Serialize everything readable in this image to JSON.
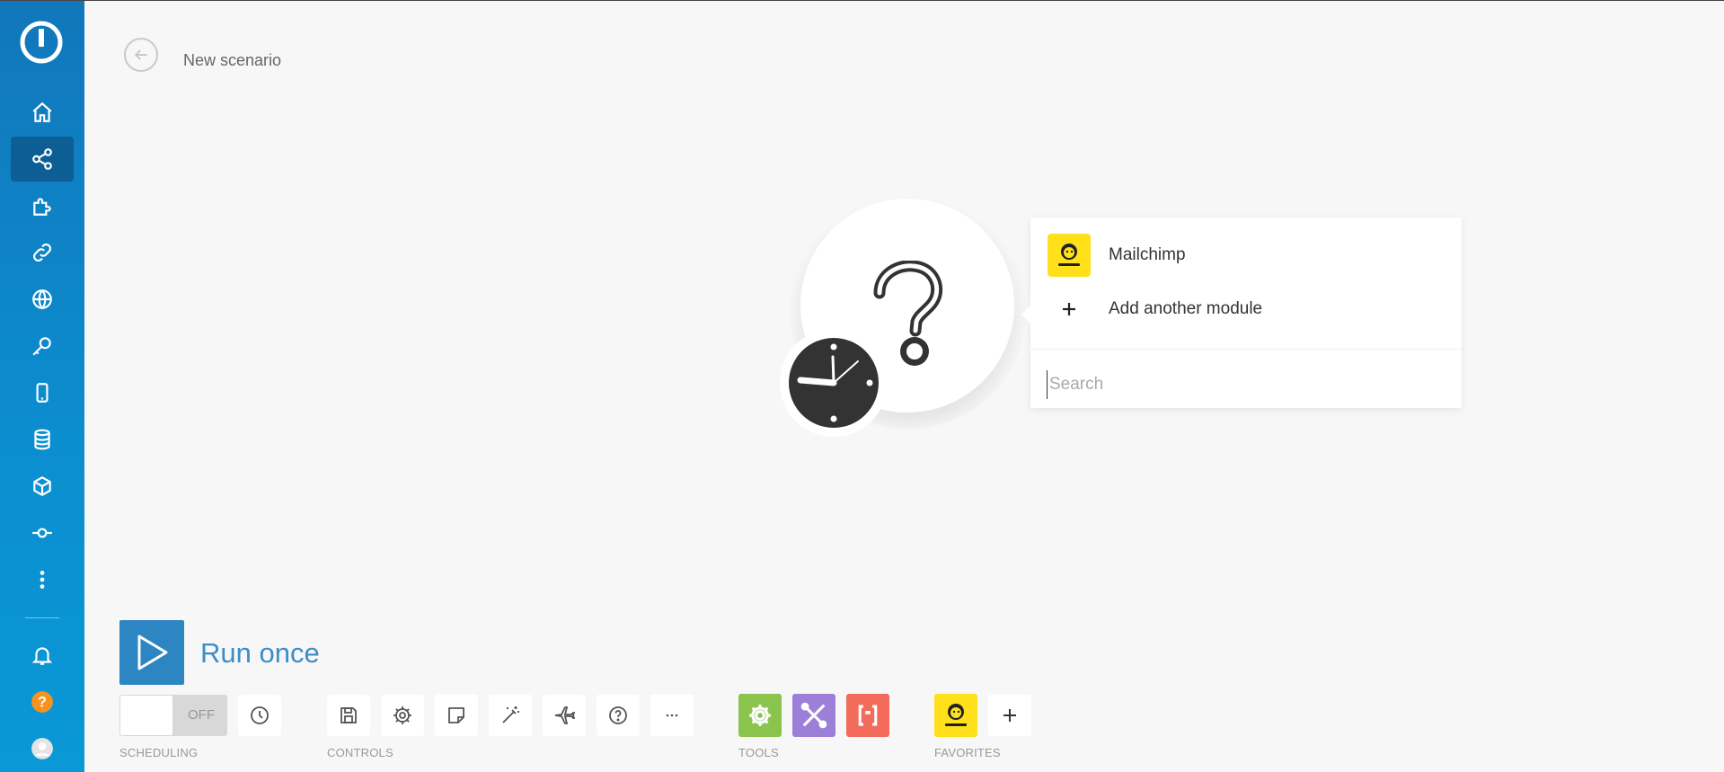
{
  "window": {
    "title": "New scenario"
  },
  "sidebar": {
    "items": [
      {
        "name": "home-icon"
      },
      {
        "name": "share-icon",
        "active": true
      },
      {
        "name": "puzzle-icon"
      },
      {
        "name": "link-icon"
      },
      {
        "name": "globe-icon"
      },
      {
        "name": "key-icon"
      },
      {
        "name": "mobile-icon"
      },
      {
        "name": "database-icon"
      },
      {
        "name": "cube-icon"
      },
      {
        "name": "commit-icon"
      },
      {
        "name": "more-vertical-icon"
      }
    ],
    "bottom": [
      {
        "name": "bell-icon"
      },
      {
        "name": "help-icon"
      },
      {
        "name": "avatar-icon"
      }
    ],
    "accent": "#0d5e94"
  },
  "popup": {
    "options": [
      {
        "label": "Mailchimp",
        "icon": "mailchimp-icon"
      },
      {
        "label": "Add another module",
        "icon": "plus-icon"
      }
    ],
    "search_placeholder": "Search"
  },
  "toolbar": {
    "run_label": "Run once",
    "toggle_label": "OFF",
    "sections": {
      "scheduling": "SCHEDULING",
      "controls": "CONTROLS",
      "tools": "TOOLS",
      "favorites": "FAVORITES"
    },
    "controls": [
      "save-icon",
      "gear-icon",
      "note-icon",
      "magic-wand-icon",
      "airplane-icon",
      "help-icon",
      "more-horizontal-icon"
    ],
    "tools": [
      {
        "name": "flow-control-icon",
        "color": "#8ac44d"
      },
      {
        "name": "tools-icon",
        "color": "#9c7fd8"
      },
      {
        "name": "text-parser-icon",
        "color": "#f26b5b"
      }
    ],
    "favorites": [
      {
        "name": "mailchimp-icon",
        "color": "#ffe01b"
      }
    ],
    "run_color": "#2d86c2"
  }
}
